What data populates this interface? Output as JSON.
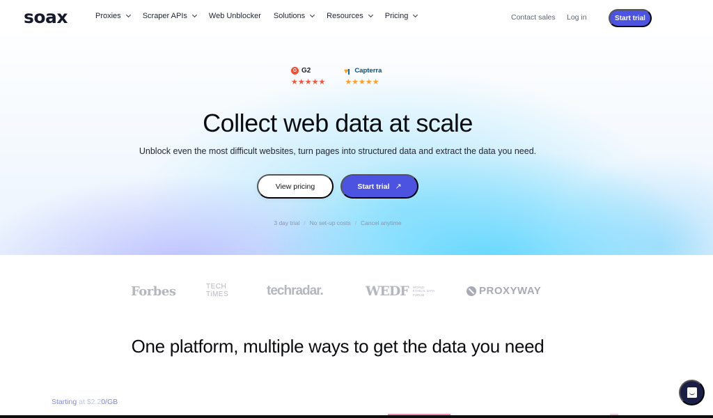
{
  "nav": {
    "logo": "soax",
    "items": [
      {
        "label": "Proxies",
        "has_dropdown": true
      },
      {
        "label": "Scraper APIs",
        "has_dropdown": true
      },
      {
        "label": "Web Unblocker",
        "has_dropdown": false
      },
      {
        "label": "Solutions",
        "has_dropdown": true
      },
      {
        "label": "Resources",
        "has_dropdown": true
      },
      {
        "label": "Pricing",
        "has_dropdown": true
      }
    ],
    "contact_sales": "Contact sales",
    "log_in": "Log in",
    "start_trial": "Start trial"
  },
  "hero": {
    "ratings": [
      {
        "name": "G2",
        "stars": 4.5,
        "icon": "g2-logo",
        "star_color": "#f1553a"
      },
      {
        "name": "Capterra",
        "stars": 5,
        "icon": "capterra-logo",
        "star_color": "#ff9d28"
      }
    ],
    "g2_logo_letter": "G",
    "star_glyphs_g2": "★★★★★",
    "star_glyphs_capterra": "★★★★★",
    "title": "Collect web data at scale",
    "subtitle": "Unblock even the most difficult websites, turn pages into structured data and extract the data you need.",
    "view_pricing": "View pricing",
    "start_trial": "Start trial",
    "start_trial_icon": "↗",
    "perks": [
      "3 day trial",
      "No set-up costs",
      "Cancel anytime"
    ],
    "perk_separator": "/"
  },
  "press_logos": {
    "forbes": "Forbes",
    "techtimes_line1": "TECH",
    "techtimes_line2": "TiMES",
    "techradar": "techradar.",
    "wedf": "WEDF",
    "wedf_sub1": "WORLD",
    "wedf_sub2": "ETHICAL DATA",
    "wedf_sub3": "FORUM",
    "proxyway": "PROXYWAY"
  },
  "section": {
    "title": "One platform, multiple ways to get the data you need",
    "starting_prefix": "Starting",
    "starting_mid": " at $2.2",
    "starting_suffix": "0/GB"
  },
  "colors": {
    "brand_accent": "#4b53e0",
    "chat_button": "#1c1f45",
    "text_dark": "#0b0c10"
  }
}
